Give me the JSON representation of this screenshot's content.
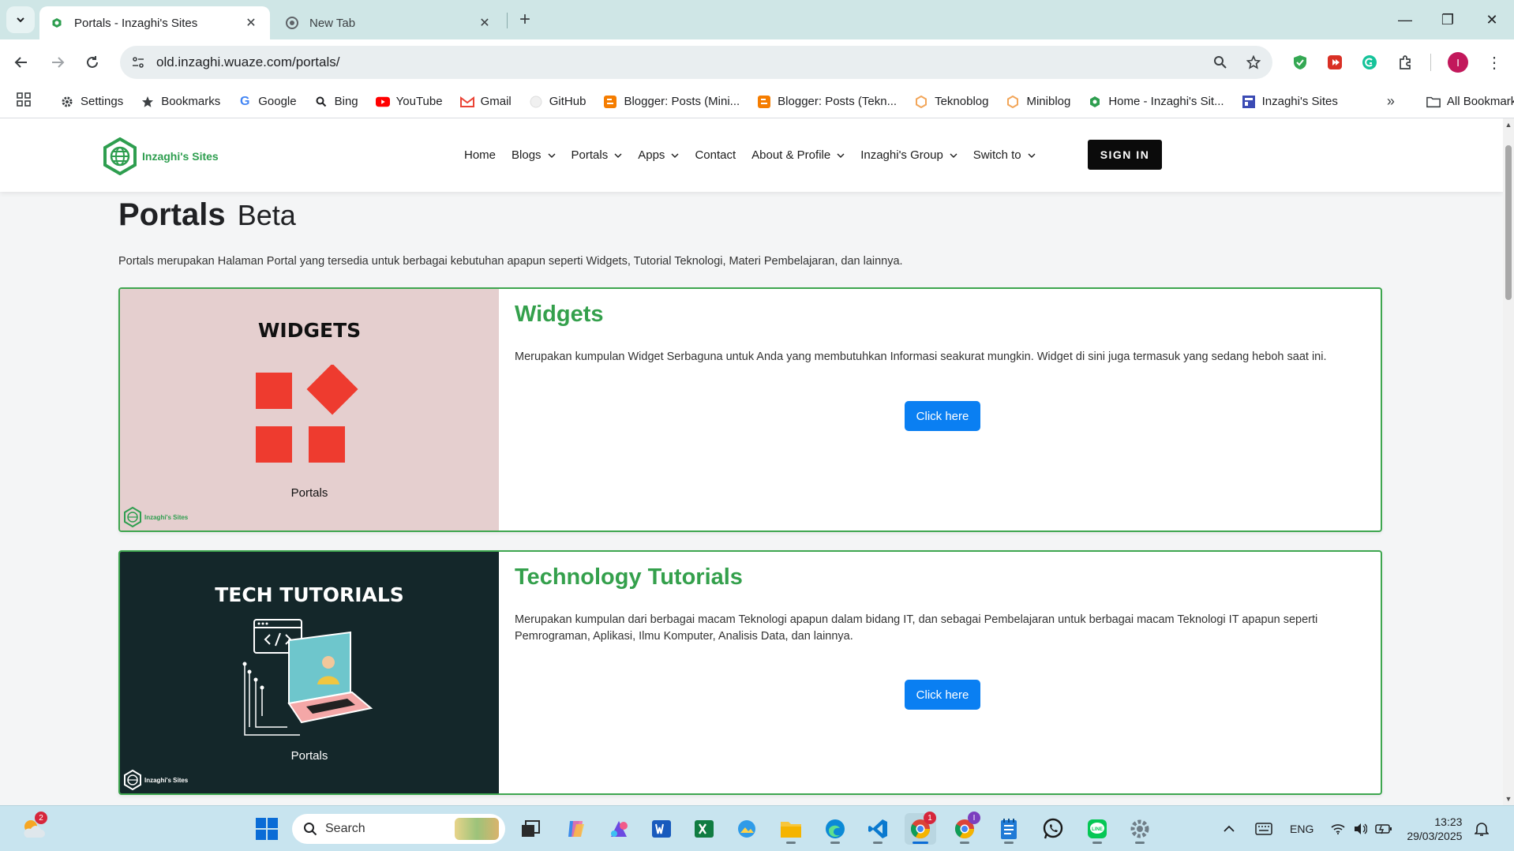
{
  "browser": {
    "tabs": [
      {
        "title": "Portals - Inzaghi's Sites",
        "active": true
      },
      {
        "title": "New Tab",
        "active": false
      }
    ],
    "url": "old.inzaghi.wuaze.com/portals/",
    "bookmarks": [
      {
        "label": "Settings",
        "icon": "gear-icon"
      },
      {
        "label": "Bookmarks",
        "icon": "star-icon"
      },
      {
        "label": "Google",
        "icon": "google-icon"
      },
      {
        "label": "Bing",
        "icon": "search-icon"
      },
      {
        "label": "YouTube",
        "icon": "youtube-icon"
      },
      {
        "label": "Gmail",
        "icon": "gmail-icon"
      },
      {
        "label": "GitHub",
        "icon": "github-icon"
      },
      {
        "label": "Blogger: Posts (Mini...",
        "icon": "blogger-icon"
      },
      {
        "label": "Blogger: Posts (Tekn...",
        "icon": "blogger-icon"
      },
      {
        "label": "Teknoblog",
        "icon": "hexagon-icon"
      },
      {
        "label": "Miniblog",
        "icon": "hexagon-icon"
      },
      {
        "label": "Home - Inzaghi's Sit...",
        "icon": "globe-icon"
      },
      {
        "label": "Inzaghi's Sites",
        "icon": "site-icon"
      }
    ],
    "all_bookmarks": "All Bookmarks",
    "profile_initial": "I"
  },
  "site": {
    "logo_text": "Inzaghi's Sites",
    "nav": [
      {
        "label": "Home",
        "dropdown": false
      },
      {
        "label": "Blogs",
        "dropdown": true
      },
      {
        "label": "Portals",
        "dropdown": true
      },
      {
        "label": "Apps",
        "dropdown": true
      },
      {
        "label": "Contact",
        "dropdown": false
      },
      {
        "label": "About & Profile",
        "dropdown": true
      },
      {
        "label": "Inzaghi's Group",
        "dropdown": true
      },
      {
        "label": "Switch to",
        "dropdown": true
      }
    ],
    "sign_in": "SIGN IN"
  },
  "page": {
    "title": "Portals",
    "title_suffix": "Beta",
    "intro": "Portals merupakan Halaman Portal yang tersedia untuk berbagai kebutuhan apapun seperti Widgets, Tutorial Teknologi, Materi Pembelajaran, dan lainnya.",
    "cards": [
      {
        "thumb_title": "WIDGETS",
        "thumb_caption": "Portals",
        "thumb_logo": "Inzaghi's Sites",
        "title": "Widgets",
        "description": "Merupakan kumpulan Widget Serbaguna untuk Anda yang membutuhkan Informasi seakurat mungkin. Widget di sini juga termasuk yang sedang heboh saat ini.",
        "button": "Click here",
        "thumb_bg": "#e5cfcf"
      },
      {
        "thumb_title": "TECH TUTORIALS",
        "thumb_caption": "Portals",
        "thumb_logo": "Inzaghi's Sites",
        "title": "Technology Tutorials",
        "description": "Merupakan kumpulan dari berbagai macam Teknologi apapun dalam bidang IT, dan sebagai Pembelajaran untuk berbagai macam Teknologi IT apapun seperti Pemrograman, Aplikasi, Ilmu Komputer, Analisis Data, dan lainnya.",
        "button": "Click here",
        "thumb_bg": "#14272a"
      }
    ]
  },
  "taskbar": {
    "search_placeholder": "Search",
    "weather_badge": "2",
    "chrome_badge": "1",
    "chrome2_badge": "I",
    "language": "ENG",
    "time": "13:23",
    "date": "29/03/2025"
  },
  "colors": {
    "accent_green": "#34a04c",
    "button_blue": "#0a7ff2",
    "brand_green": "#2e9e4f"
  }
}
